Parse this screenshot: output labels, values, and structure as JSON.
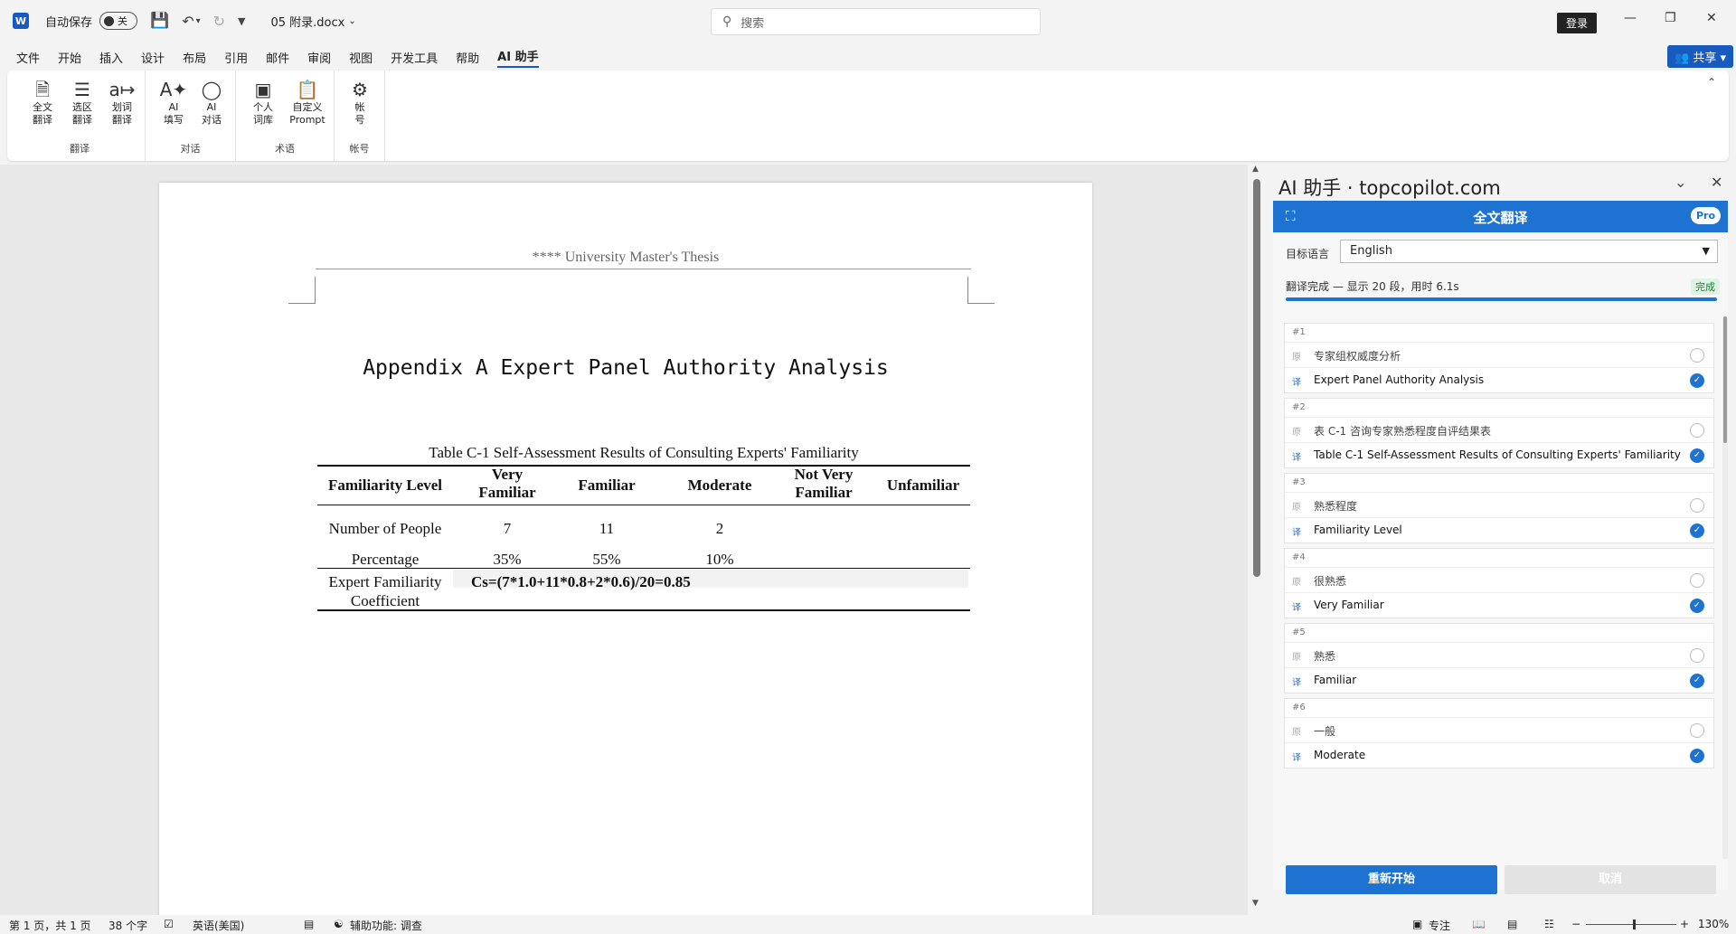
{
  "titlebar": {
    "autosave_label": "自动保存",
    "autosave_state": "关",
    "doc_name": "05 附录.docx",
    "search_placeholder": "搜索",
    "login_label": "登录"
  },
  "menu": {
    "tabs": [
      "文件",
      "开始",
      "插入",
      "设计",
      "布局",
      "引用",
      "邮件",
      "审阅",
      "视图",
      "开发工具",
      "帮助",
      "AI 助手"
    ],
    "active": "AI 助手",
    "share_label": "共享"
  },
  "ribbon": {
    "groups": [
      {
        "label": "翻译",
        "buttons": [
          {
            "line1": "全文",
            "line2": "翻译",
            "icon": "document-translate-icon"
          },
          {
            "line1": "选区",
            "line2": "翻译",
            "icon": "selection-translate-icon"
          },
          {
            "line1": "划词",
            "line2": "翻译",
            "icon": "word-translate-icon"
          }
        ]
      },
      {
        "label": "对话",
        "buttons": [
          {
            "line1": "AI",
            "line2": "填写",
            "icon": "ai-fill-icon"
          },
          {
            "line1": "AI",
            "line2": "对话",
            "icon": "ai-chat-icon"
          }
        ]
      },
      {
        "label": "术语",
        "buttons": [
          {
            "line1": "个人",
            "line2": "词库",
            "icon": "dictionary-icon"
          },
          {
            "line1": "自定义",
            "line2": "Prompt",
            "icon": "prompt-icon"
          }
        ]
      },
      {
        "label": "帐号",
        "buttons": [
          {
            "line1": "帐",
            "line2": "号",
            "icon": "account-icon"
          }
        ]
      }
    ]
  },
  "document": {
    "header": "**** University Master's Thesis",
    "title": "Appendix A Expert Panel Authority Analysis",
    "table_caption": "Table C-1 Self-Assessment Results of Consulting Experts' Familiarity",
    "table": {
      "headers": [
        "Familiarity Level",
        "Very\nFamiliar",
        "Familiar",
        "Moderate",
        "Not Very\nFamiliar",
        "Unfamiliar"
      ],
      "row_people_label": "Number of People",
      "row_people": [
        "7",
        "11",
        "2"
      ],
      "row_pct_label": "Percentage",
      "row_pct": [
        "35%",
        "55%",
        "10%"
      ],
      "coef_label_1": "Expert Familiarity",
      "coef_label_2": "Coefficient",
      "coef_formula": "Cs=(7*1.0+11*0.8+2*0.6)/20=0.85"
    }
  },
  "panel": {
    "title": "AI 助手 · topcopilot.com",
    "header_title": "全文翻译",
    "pro_badge": "Pro",
    "lang_label": "目标语言",
    "lang_value": "English",
    "status_text": "翻译完成 — 显示 20 段，用时 6.1s",
    "done_badge": "完成",
    "progress": 1.0,
    "src_tag": "原",
    "tgt_tag": "译",
    "segments": [
      {
        "num": "#1",
        "src": "专家组权威度分析",
        "tgt": "Expert Panel Authority Analysis"
      },
      {
        "num": "#2",
        "src": "表 C-1 咨询专家熟悉程度自评结果表",
        "tgt": "Table C-1 Self-Assessment Results of Consulting Experts' Familiarity"
      },
      {
        "num": "#3",
        "src": "熟悉程度",
        "tgt": "Familiarity Level"
      },
      {
        "num": "#4",
        "src": "很熟悉",
        "tgt": "Very Familiar"
      },
      {
        "num": "#5",
        "src": "熟悉",
        "tgt": "Familiar"
      },
      {
        "num": "#6",
        "src": "一般",
        "tgt": "Moderate"
      }
    ],
    "restart_label": "重新开始",
    "cancel_label": "取消"
  },
  "statusbar": {
    "page": "第 1 页，共 1 页",
    "words": "38 个字",
    "language": "英语(美国)",
    "accessibility": "辅助功能: 调查",
    "focus": "专注",
    "zoom": "130%"
  }
}
